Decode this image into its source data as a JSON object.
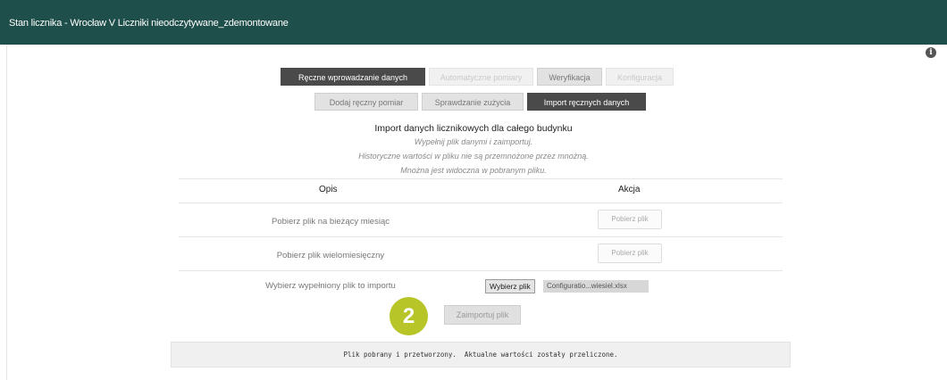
{
  "window": {
    "title": "Stan licznika - Wrocław V Liczniki nieodczytywane_zdemontowane"
  },
  "icons": {
    "info": "info-icon"
  },
  "tabs_primary": [
    {
      "label": "Ręczne wprowadzanie danych",
      "state": "active"
    },
    {
      "label": "Automatyczne pomiary",
      "state": "disabled"
    },
    {
      "label": "Weryfikacja",
      "state": "normal"
    },
    {
      "label": "Konfiguracja",
      "state": "disabled"
    }
  ],
  "tabs_secondary": [
    {
      "label": "Dodaj ręczny pomiar",
      "state": "normal"
    },
    {
      "label": "Sprawdzanie zużycia",
      "state": "normal"
    },
    {
      "label": "Import ręcznych danych",
      "state": "active"
    }
  ],
  "import": {
    "title": "Import danych licznikowych dla całego budynku",
    "hints": [
      "Wypełnij plik danymi i zaimportuj.",
      "Historyczne wartości w pliku nie są przemnożone przez mnożną.",
      "Mnożna jest widoczna w pobranym pliku."
    ]
  },
  "table": {
    "headers": {
      "description": "Opis",
      "action": "Akcja"
    },
    "rows": [
      {
        "label": "Pobierz plik na bieżący miesiąc",
        "action": "Pobierz plik"
      },
      {
        "label": "Pobierz plik wielomiesięczny",
        "action": "Pobierz plik"
      },
      {
        "label": "Wybierz wypełniony plik to importu",
        "choose_label": "Wybierz plik",
        "file_name": "Configuratio...wiesiel.xlsx"
      }
    ]
  },
  "step_badge": "2",
  "import_button": "Zaimportuj plik",
  "status_message": "Plik pobrany i przetworzony.  Aktualne wartości zostały przeliczone.",
  "colors": {
    "header_bg": "#1f4f4a",
    "active_tab": "#4a4a4a",
    "badge": "#b7c529"
  }
}
